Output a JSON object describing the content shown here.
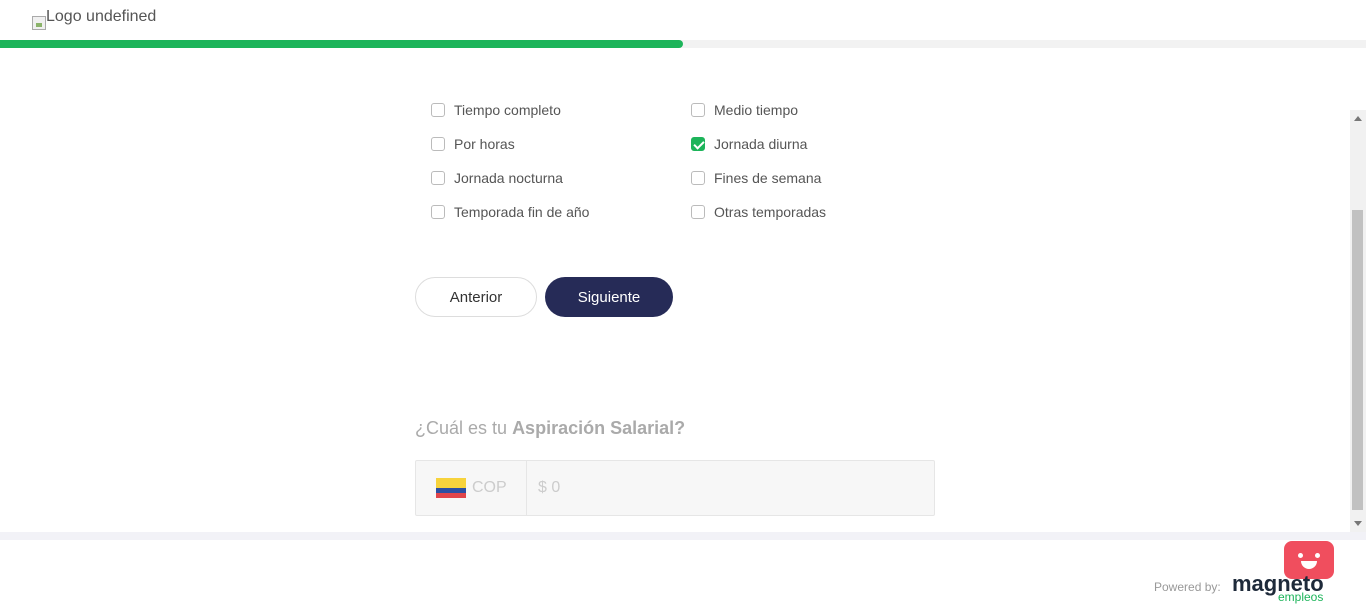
{
  "header": {
    "logo_alt": "Logo undefined",
    "progress_percent": 50
  },
  "schedule_options": {
    "left": [
      {
        "label": "Tiempo completo",
        "checked": false
      },
      {
        "label": "Por horas",
        "checked": false
      },
      {
        "label": "Jornada nocturna",
        "checked": false
      },
      {
        "label": "Temporada fin de año",
        "checked": false
      }
    ],
    "right": [
      {
        "label": "Medio tiempo",
        "checked": false
      },
      {
        "label": "Jornada diurna",
        "checked": true
      },
      {
        "label": "Fines de semana",
        "checked": false
      },
      {
        "label": "Otras temporadas",
        "checked": false
      }
    ]
  },
  "buttons": {
    "previous": "Anterior",
    "next": "Siguiente"
  },
  "salary": {
    "question_prefix": "¿Cuál es tu",
    "question_bold": "Aspiración Salarial?",
    "currency": "COP",
    "flag_colors": [
      "#f7d33c",
      "#2b4fa3",
      "#e0454b"
    ],
    "amount_placeholder": "$ 0"
  },
  "footer": {
    "powered_by": "Powered by:",
    "brand": "magneto",
    "brand_sub": "empleos"
  },
  "colors": {
    "accent_green": "#1db45a",
    "primary_navy": "#262b57",
    "chat_red": "#f04e5e"
  }
}
